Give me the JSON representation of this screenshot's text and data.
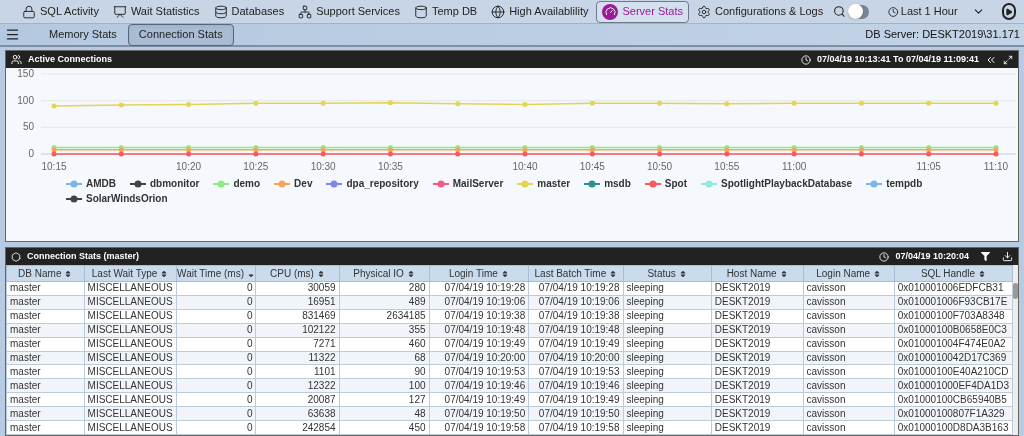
{
  "nav": {
    "items": [
      {
        "label": "SQL Activity",
        "selected": false
      },
      {
        "label": "Wait Statistics",
        "selected": false
      },
      {
        "label": "Databases",
        "selected": false
      },
      {
        "label": "Support Services",
        "selected": false
      },
      {
        "label": "Temp DB",
        "selected": false
      },
      {
        "label": "High Availablility",
        "selected": false
      },
      {
        "label": "Server Stats",
        "selected": true
      },
      {
        "label": "Configurations & Logs",
        "selected": false
      }
    ],
    "toggle": {
      "on": false
    },
    "time_range": "Last 1 Hour"
  },
  "subtabs": [
    {
      "label": "Memory Stats",
      "selected": false
    },
    {
      "label": "Connection Stats",
      "selected": true
    }
  ],
  "db_server": "DB Server: DESKT2019\\31.171",
  "active_connections": {
    "title": "Active Connections",
    "range": "07/04/19 10:13:41 To 07/04/19 11:09:41",
    "chart_data": {
      "type": "line",
      "legend": "bottom",
      "categories": [
        "10:15",
        null,
        "10:20",
        "10:25",
        "10:30",
        "10:35",
        null,
        "10:40",
        "10:45",
        "10:50",
        "10:55",
        "11:00",
        null,
        "11:05",
        "11:10"
      ],
      "ylim": [
        0,
        150
      ],
      "yticks": [
        0,
        50,
        100,
        150
      ],
      "series": [
        {
          "name": "AMDB",
          "color": "#7cb5ec",
          "values": [
            null,
            null,
            null,
            null,
            null,
            null,
            null,
            null,
            null,
            null,
            null,
            null,
            null,
            null,
            null
          ]
        },
        {
          "name": "dbmonitor",
          "color": "#434348",
          "values": [
            null,
            null,
            null,
            null,
            null,
            null,
            null,
            null,
            null,
            null,
            null,
            null,
            null,
            null,
            null
          ]
        },
        {
          "name": "demo",
          "color": "#90ed7d",
          "values": [
            12,
            12,
            12,
            12,
            12,
            12,
            12,
            12,
            12,
            12,
            12,
            12,
            12,
            12,
            12
          ]
        },
        {
          "name": "Dev",
          "color": "#f7a35c",
          "values": [
            8,
            8,
            8,
            8,
            8,
            8,
            8,
            8,
            8,
            8,
            8,
            8,
            8,
            8,
            8
          ]
        },
        {
          "name": "dpa_repository",
          "color": "#8085e9",
          "values": [
            null,
            null,
            null,
            null,
            null,
            null,
            null,
            null,
            null,
            null,
            null,
            null,
            null,
            null,
            null
          ]
        },
        {
          "name": "MailServer",
          "color": "#f15c80",
          "values": [
            null,
            null,
            null,
            null,
            null,
            null,
            null,
            null,
            null,
            null,
            null,
            null,
            null,
            null,
            null
          ]
        },
        {
          "name": "master",
          "color": "#e4d354",
          "values": [
            90,
            92,
            93,
            95,
            95,
            96,
            94,
            93,
            95,
            95,
            94,
            95,
            95,
            95,
            95
          ]
        },
        {
          "name": "msdb",
          "color": "#2b908f",
          "values": [
            null,
            null,
            null,
            null,
            null,
            null,
            null,
            null,
            null,
            null,
            null,
            null,
            null,
            null,
            null
          ]
        },
        {
          "name": "Spot",
          "color": "#f45b5b",
          "values": [
            0,
            0,
            0,
            0,
            0,
            0,
            0,
            0,
            0,
            0,
            0,
            0,
            0,
            0,
            0
          ]
        },
        {
          "name": "SpotlightPlaybackDatabase",
          "color": "#91e8e1",
          "values": [
            null,
            null,
            null,
            null,
            null,
            null,
            null,
            null,
            null,
            null,
            null,
            null,
            null,
            null,
            null
          ]
        },
        {
          "name": "tempdb",
          "color": "#7cb5ec",
          "values": [
            null,
            null,
            null,
            null,
            null,
            null,
            null,
            null,
            null,
            null,
            null,
            null,
            null,
            null,
            null
          ]
        },
        {
          "name": "SolarWindsOrion",
          "color": "#434348",
          "values": [
            null,
            null,
            null,
            null,
            null,
            null,
            null,
            null,
            null,
            null,
            null,
            null,
            null,
            null,
            null
          ]
        }
      ]
    }
  },
  "connection_stats": {
    "title": "Connection Stats (master)",
    "timestamp": "07/04/19 10:20:04",
    "columns": [
      {
        "label": "DB Name",
        "sorted": false
      },
      {
        "label": "Last Wait Type",
        "sorted": false
      },
      {
        "label": "Wait Time (ms)",
        "sorted": true
      },
      {
        "label": "CPU (ms)",
        "sorted": false
      },
      {
        "label": "Physical IO",
        "sorted": false
      },
      {
        "label": "Login Time",
        "sorted": false
      },
      {
        "label": "Last Batch Time",
        "sorted": false
      },
      {
        "label": "Status",
        "sorted": false
      },
      {
        "label": "Host Name",
        "sorted": false
      },
      {
        "label": "Login Name",
        "sorted": false
      },
      {
        "label": "SQL Handle",
        "sorted": false
      }
    ],
    "rows": [
      [
        "master",
        "MISCELLANEOUS",
        "0",
        "30059",
        "280",
        "07/04/19 10:19:28",
        "07/04/19 10:19:28",
        "sleeping",
        "DESKT2019",
        "cavisson",
        "0x010001006EDFCB31"
      ],
      [
        "master",
        "MISCELLANEOUS",
        "0",
        "16951",
        "489",
        "07/04/19 10:19:06",
        "07/04/19 10:19:06",
        "sleeping",
        "DESKT2019",
        "cavisson",
        "0x010001006F93CB17E"
      ],
      [
        "master",
        "MISCELLANEOUS",
        "0",
        "831469",
        "2634185",
        "07/04/19 10:19:38",
        "07/04/19 10:19:38",
        "sleeping",
        "DESKT2019",
        "cavisson",
        "0x01000100F703A8348"
      ],
      [
        "master",
        "MISCELLANEOUS",
        "0",
        "102122",
        "355",
        "07/04/19 10:19:48",
        "07/04/19 10:19:48",
        "sleeping",
        "DESKT2019",
        "cavisson",
        "0x01000100B0658E0C3"
      ],
      [
        "master",
        "MISCELLANEOUS",
        "0",
        "7271",
        "460",
        "07/04/19 10:19:49",
        "07/04/19 10:19:49",
        "sleeping",
        "DESKT2019",
        "cavisson",
        "0x010001004F474E0A2"
      ],
      [
        "master",
        "MISCELLANEOUS",
        "0",
        "11322",
        "68",
        "07/04/19 10:20:00",
        "07/04/19 10:20:00",
        "sleeping",
        "DESKT2019",
        "cavisson",
        "0x0100010042D17C369"
      ],
      [
        "master",
        "MISCELLANEOUS",
        "0",
        "1101",
        "90",
        "07/04/19 10:19:53",
        "07/04/19 10:19:53",
        "sleeping",
        "DESKT2019",
        "cavisson",
        "0x01000100E40A210CD"
      ],
      [
        "master",
        "MISCELLANEOUS",
        "0",
        "12322",
        "100",
        "07/04/19 10:19:46",
        "07/04/19 10:19:46",
        "sleeping",
        "DESKT2019",
        "cavisson",
        "0x010001000EF4DA1D3"
      ],
      [
        "master",
        "MISCELLANEOUS",
        "0",
        "20087",
        "127",
        "07/04/19 10:19:49",
        "07/04/19 10:19:49",
        "sleeping",
        "DESKT2019",
        "cavisson",
        "0x01000100CB65940B5"
      ],
      [
        "master",
        "MISCELLANEOUS",
        "0",
        "63638",
        "48",
        "07/04/19 10:19:50",
        "07/04/19 10:19:50",
        "sleeping",
        "DESKT2019",
        "cavisson",
        "0x01000100807F1A329"
      ],
      [
        "master",
        "MISCELLANEOUS",
        "0",
        "242854",
        "450",
        "07/04/19 10:19:58",
        "07/04/19 10:19:58",
        "sleeping",
        "DESKT2019",
        "cavisson",
        "0x01000100D8DA3B163"
      ]
    ]
  }
}
